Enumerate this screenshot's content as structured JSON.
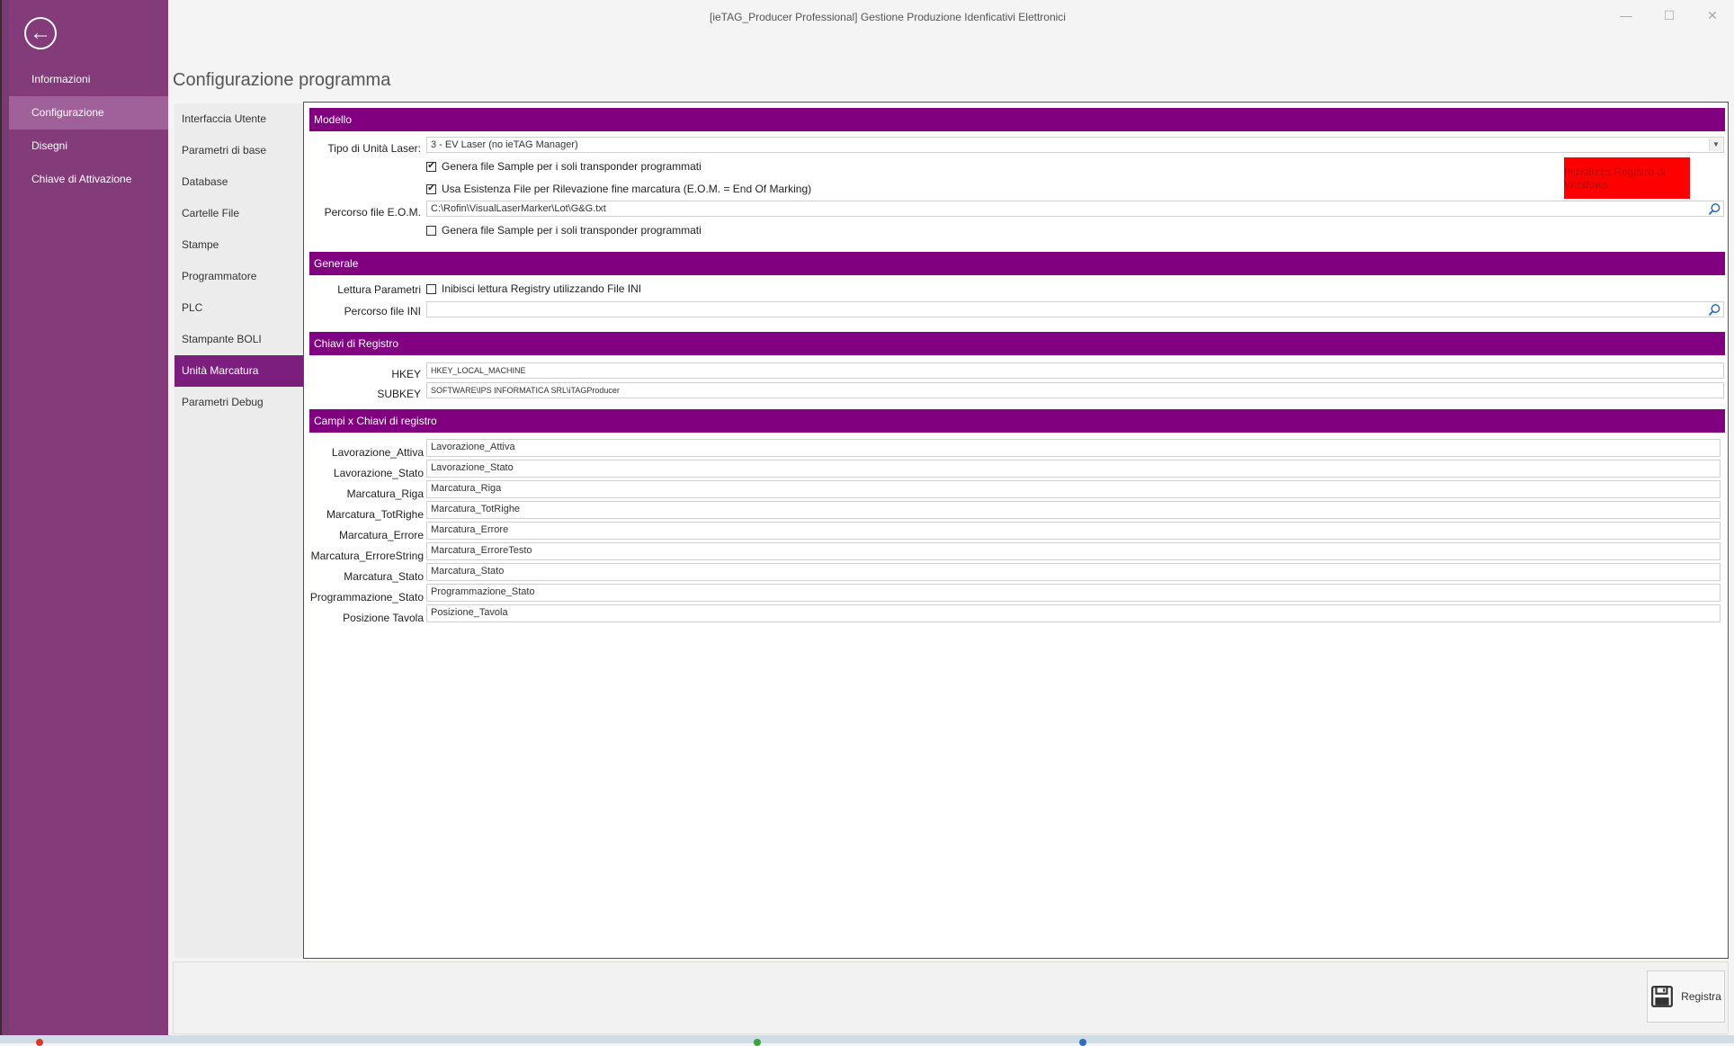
{
  "window": {
    "title": "[ieTAG_Producer Professional] Gestione Produzione Idenficativi Elettronici",
    "minimize": "—",
    "maximize": "☐",
    "close": "✕"
  },
  "sidebar": {
    "back_icon": "←",
    "items": [
      {
        "label": "Informazioni"
      },
      {
        "label": "Configurazione"
      },
      {
        "label": "Disegni"
      },
      {
        "label": "Chiave di Attivazione"
      }
    ]
  },
  "page_title": "Configurazione programma",
  "nav": {
    "items": [
      {
        "label": "Interfaccia Utente"
      },
      {
        "label": "Parametri di base"
      },
      {
        "label": "Database"
      },
      {
        "label": "Cartelle File"
      },
      {
        "label": "Stampe"
      },
      {
        "label": "Programmatore"
      },
      {
        "label": "PLC"
      },
      {
        "label": "Stampante BOLI"
      },
      {
        "label": "Unità Marcatura"
      },
      {
        "label": "Parametri Debug"
      }
    ]
  },
  "modello": {
    "header": "Modello",
    "tipo_label": "Tipo di Unità Laser:",
    "tipo_value": "3 - EV Laser (no ieTAG Manager)",
    "chk1_label": "Genera file Sample per i soli transponder programmati",
    "chk1_checked": "✔",
    "chk2_label": "Usa Esistenza File per Rilevazione fine marcatura (E.O.M. = End Of Marking)",
    "chk2_checked": "✔",
    "eom_label": "Percorso file E.O.M.",
    "eom_value": "C:\\Rofin\\VisualLaserMarker\\Lot\\G&G.txt",
    "chk3_label": "Genera file Sample per i soli transponder programmati",
    "chk3_checked": "",
    "red_button": "Inizializza Registro di Windows"
  },
  "generale": {
    "header": "Generale",
    "lettura_label": "Lettura Parametri",
    "lettura_chk_label": "Inibisci lettura Registry utilizzando File INI",
    "lettura_checked": "",
    "ini_label": "Percorso file INI",
    "ini_value": ""
  },
  "chiavi": {
    "header": "Chiavi di Registro",
    "hkey_label": "HKEY",
    "hkey_value": "HKEY_LOCAL_MACHINE",
    "subkey_label": "SUBKEY",
    "subkey_value": "SOFTWARE\\IPS INFORMATICA SRL\\iTAGProducer"
  },
  "campi": {
    "header": "Campi x Chiavi di registro",
    "rows": [
      {
        "label": "Lavorazione_Attiva",
        "value": "Lavorazione_Attiva"
      },
      {
        "label": "Lavorazione_Stato",
        "value": "Lavorazione_Stato"
      },
      {
        "label": "Marcatura_Riga",
        "value": "Marcatura_Riga"
      },
      {
        "label": "Marcatura_TotRighe",
        "value": "Marcatura_TotRighe"
      },
      {
        "label": "Marcatura_Errore",
        "value": "Marcatura_Errore"
      },
      {
        "label": "Marcatura_ErroreString",
        "value": "Marcatura_ErroreTesto"
      },
      {
        "label": "Marcatura_Stato",
        "value": "Marcatura_Stato"
      },
      {
        "label": "Programmazione_Stato",
        "value": "Programmazione_Stato"
      },
      {
        "label": "Posizione Tavola",
        "value": "Posizione_Tavola"
      }
    ]
  },
  "footer": {
    "save_label": "Registra"
  },
  "colors": {
    "sidebar": "#833b79",
    "accent": "#800080",
    "danger": "#ff0000"
  }
}
